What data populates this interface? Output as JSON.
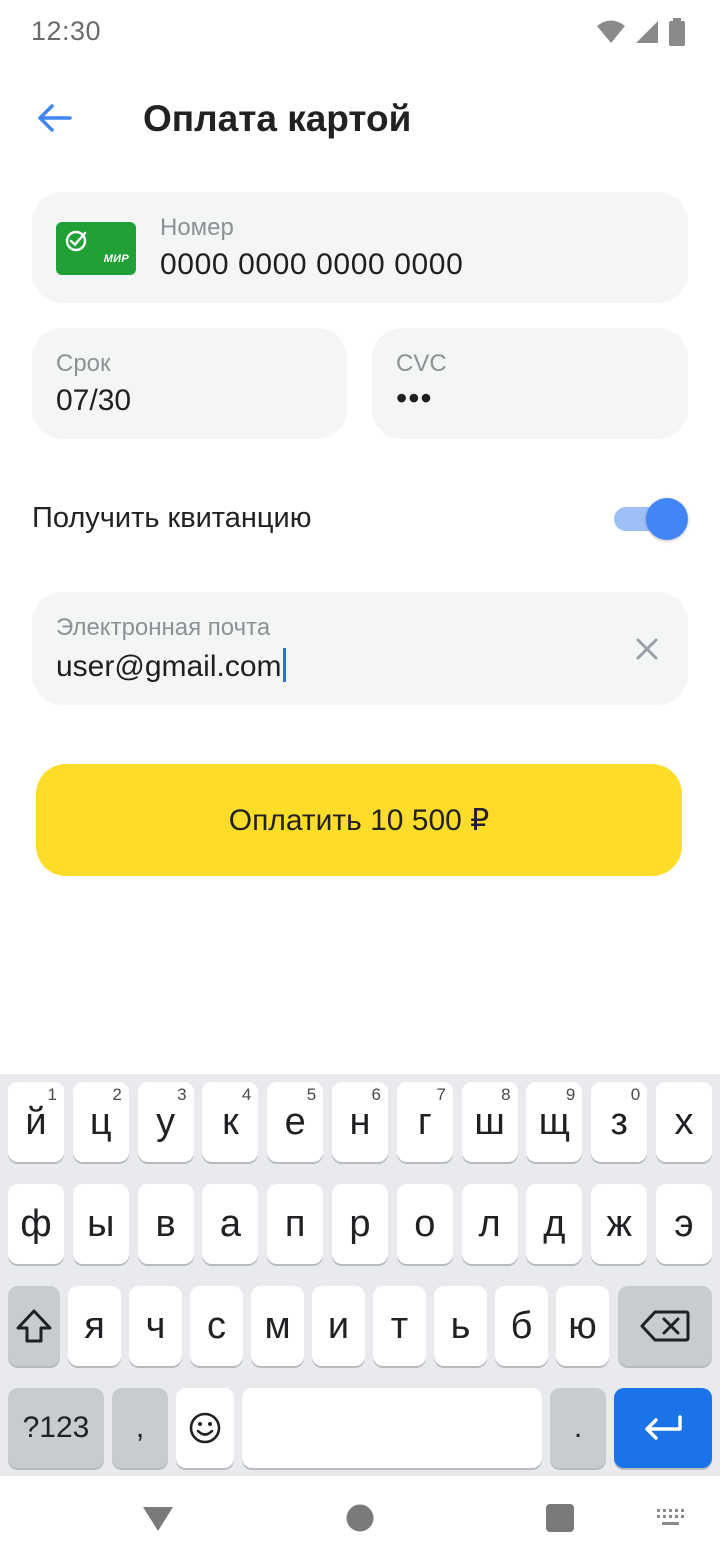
{
  "status_bar": {
    "time": "12:30"
  },
  "header": {
    "title": "Оплата картой"
  },
  "card": {
    "number_label": "Номер",
    "number_value": "0000 0000 0000 0000",
    "logo_text": "МИР",
    "logo_icon": "sber-checkmark-icon"
  },
  "expiry": {
    "label": "Срок",
    "value": "07/30"
  },
  "cvc": {
    "label": "CVC",
    "value": "•••"
  },
  "receipt": {
    "label": "Получить квитанцию",
    "toggle_on": true
  },
  "email": {
    "label": "Электронная почта",
    "value": "user@gmail.com"
  },
  "pay_button": {
    "label": "Оплатить 10 500 ₽"
  },
  "keyboard": {
    "row1": [
      {
        "k": "й",
        "n": "1"
      },
      {
        "k": "ц",
        "n": "2"
      },
      {
        "k": "у",
        "n": "3"
      },
      {
        "k": "к",
        "n": "4"
      },
      {
        "k": "е",
        "n": "5"
      },
      {
        "k": "н",
        "n": "6"
      },
      {
        "k": "г",
        "n": "7"
      },
      {
        "k": "ш",
        "n": "8"
      },
      {
        "k": "щ",
        "n": "9"
      },
      {
        "k": "з",
        "n": "0"
      },
      {
        "k": "х",
        "n": ""
      }
    ],
    "row2": [
      "ф",
      "ы",
      "в",
      "а",
      "п",
      "р",
      "о",
      "л",
      "д",
      "ж",
      "э"
    ],
    "row3": [
      "я",
      "ч",
      "с",
      "м",
      "и",
      "т",
      "ь",
      "б",
      "ю"
    ],
    "symbols_label": "?123",
    "comma_label": ",",
    "period_label": "."
  },
  "colors": {
    "accent": "#4285f4",
    "pay_button": "#fedc2a",
    "card_logo": "#21a038",
    "field_bg": "#f4f6f5",
    "enter_key": "#1a73e8"
  }
}
